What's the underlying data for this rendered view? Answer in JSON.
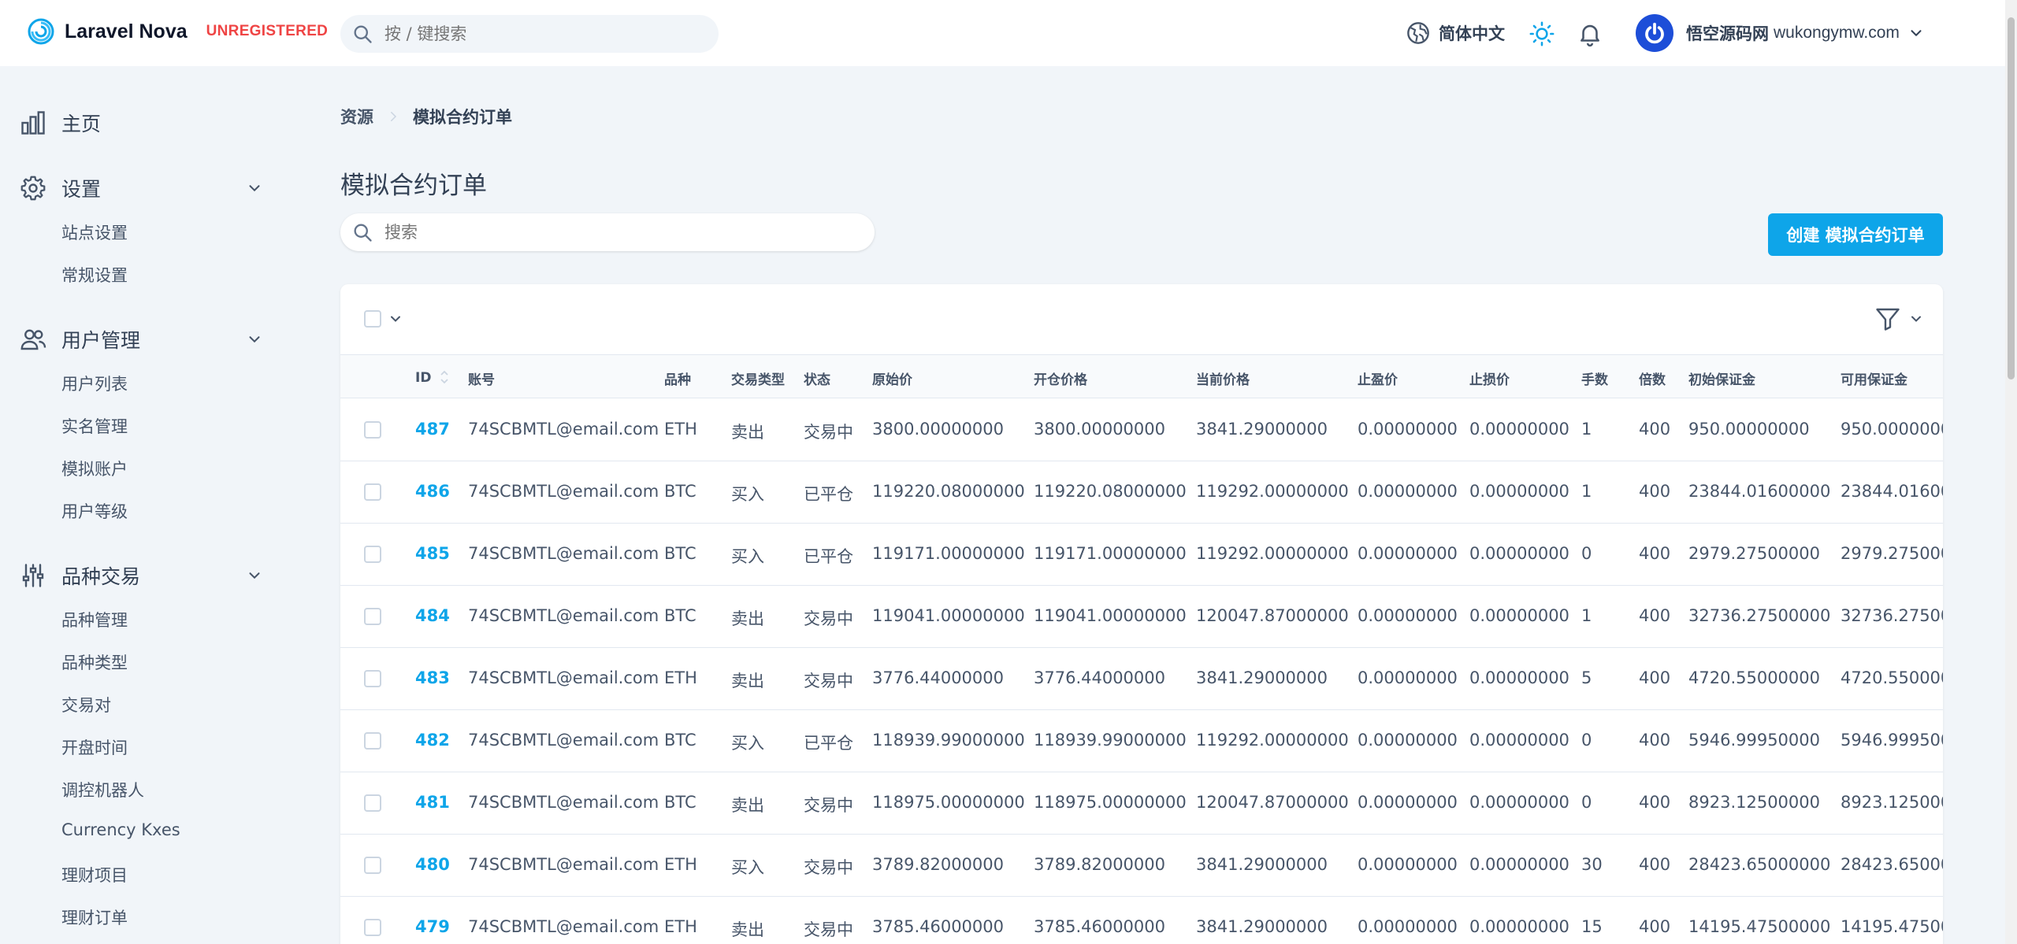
{
  "header": {
    "brand": "Laravel Nova",
    "unregistered": "UNREGISTERED",
    "search_placeholder": "按 / 键搜索",
    "language": "简体中文",
    "user_name": "悟空源码网",
    "user_email": "wukongymw.com"
  },
  "sidebar": {
    "home": "主页",
    "groups": [
      {
        "label": "设置",
        "items": [
          "站点设置",
          "常规设置"
        ]
      },
      {
        "label": "用户管理",
        "items": [
          "用户列表",
          "实名管理",
          "模拟账户",
          "用户等级"
        ]
      },
      {
        "label": "品种交易",
        "items": [
          "品种管理",
          "品种类型",
          "交易对",
          "开盘时间",
          "调控机器人",
          "Currency Kxes",
          "理财项目",
          "理财订单"
        ]
      }
    ]
  },
  "breadcrumb": {
    "root": "资源",
    "current": "模拟合约订单"
  },
  "page": {
    "title": "模拟合约订单",
    "search_placeholder": "搜索",
    "create_button": "创建 模拟合约订单"
  },
  "table": {
    "columns": [
      "ID",
      "账号",
      "品种",
      "交易类型",
      "状态",
      "原始价",
      "开仓价格",
      "当前价格",
      "止盈价",
      "止损价",
      "手数",
      "倍数",
      "初始保证金",
      "可用保证金"
    ],
    "rows": [
      [
        "487",
        "74SCBMTL@email.com",
        "ETH",
        "卖出",
        "交易中",
        "3800.00000000",
        "3800.00000000",
        "3841.29000000",
        "0.00000000",
        "0.00000000",
        "1",
        "400",
        "950.00000000",
        "950.0000000"
      ],
      [
        "486",
        "74SCBMTL@email.com",
        "BTC",
        "买入",
        "已平仓",
        "119220.08000000",
        "119220.08000000",
        "119292.00000000",
        "0.00000000",
        "0.00000000",
        "1",
        "400",
        "23844.01600000",
        "23844.01600"
      ],
      [
        "485",
        "74SCBMTL@email.com",
        "BTC",
        "买入",
        "已平仓",
        "119171.00000000",
        "119171.00000000",
        "119292.00000000",
        "0.00000000",
        "0.00000000",
        "0",
        "400",
        "2979.27500000",
        "2979.275000"
      ],
      [
        "484",
        "74SCBMTL@email.com",
        "BTC",
        "卖出",
        "交易中",
        "119041.00000000",
        "119041.00000000",
        "120047.87000000",
        "0.00000000",
        "0.00000000",
        "1",
        "400",
        "32736.27500000",
        "32736.27500"
      ],
      [
        "483",
        "74SCBMTL@email.com",
        "ETH",
        "卖出",
        "交易中",
        "3776.44000000",
        "3776.44000000",
        "3841.29000000",
        "0.00000000",
        "0.00000000",
        "5",
        "400",
        "4720.55000000",
        "4720.550000"
      ],
      [
        "482",
        "74SCBMTL@email.com",
        "BTC",
        "买入",
        "已平仓",
        "118939.99000000",
        "118939.99000000",
        "119292.00000000",
        "0.00000000",
        "0.00000000",
        "0",
        "400",
        "5946.99950000",
        "5946.999500"
      ],
      [
        "481",
        "74SCBMTL@email.com",
        "BTC",
        "卖出",
        "交易中",
        "118975.00000000",
        "118975.00000000",
        "120047.87000000",
        "0.00000000",
        "0.00000000",
        "0",
        "400",
        "8923.12500000",
        "8923.125000"
      ],
      [
        "480",
        "74SCBMTL@email.com",
        "ETH",
        "买入",
        "交易中",
        "3789.82000000",
        "3789.82000000",
        "3841.29000000",
        "0.00000000",
        "0.00000000",
        "30",
        "400",
        "28423.65000000",
        "28423.65000"
      ],
      [
        "479",
        "74SCBMTL@email.com",
        "ETH",
        "卖出",
        "交易中",
        "3785.46000000",
        "3785.46000000",
        "3841.29000000",
        "0.00000000",
        "0.00000000",
        "15",
        "400",
        "14195.47500000",
        "14195.47500"
      ]
    ]
  }
}
